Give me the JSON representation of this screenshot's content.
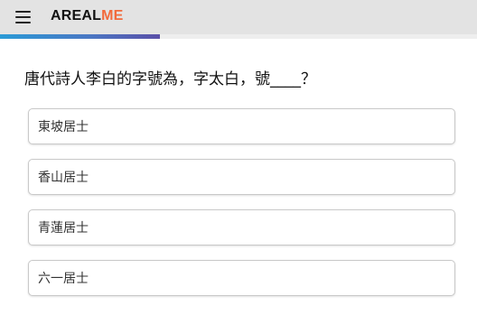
{
  "header": {
    "logo_main": "AREAL",
    "logo_accent": "ME",
    "accent_color": "#f26a3c",
    "menu_icon": "hamburger-menu-icon"
  },
  "progress": {
    "fraction": 0.335
  },
  "quiz": {
    "question": "唐代詩人李白的字號為，字太白，號____？",
    "options": [
      {
        "label": "東坡居士"
      },
      {
        "label": "香山居士"
      },
      {
        "label": "青蓮居士"
      },
      {
        "label": "六一居士"
      }
    ]
  }
}
